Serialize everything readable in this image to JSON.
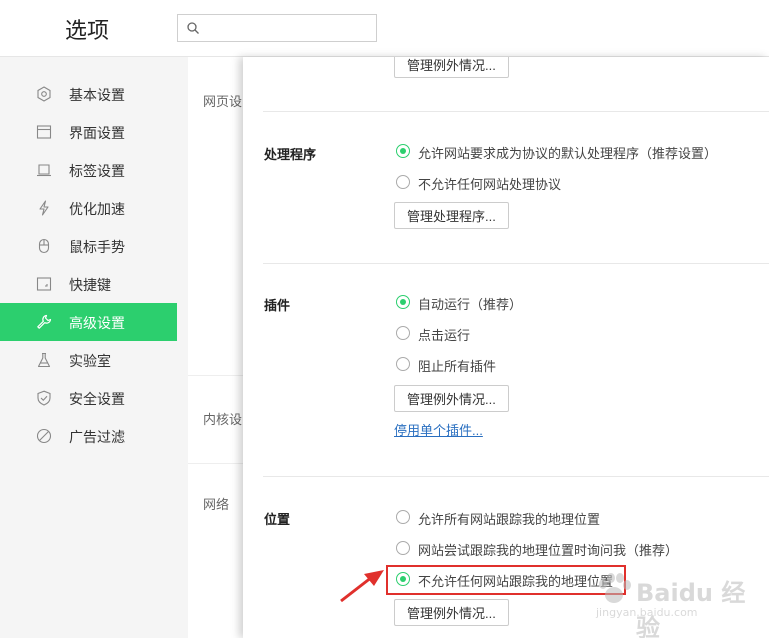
{
  "header": {
    "title": "选项",
    "search_placeholder": ""
  },
  "sidebar": {
    "items": [
      {
        "label": "基本设置",
        "icon": "gear-icon"
      },
      {
        "label": "界面设置",
        "icon": "window-icon"
      },
      {
        "label": "标签设置",
        "icon": "tab-icon"
      },
      {
        "label": "优化加速",
        "icon": "lightning-icon"
      },
      {
        "label": "鼠标手势",
        "icon": "mouse-icon"
      },
      {
        "label": "快捷键",
        "icon": "keyboard-icon"
      },
      {
        "label": "高级设置",
        "icon": "wrench-icon",
        "active": true
      },
      {
        "label": "实验室",
        "icon": "flask-icon"
      },
      {
        "label": "安全设置",
        "icon": "shield-icon"
      },
      {
        "label": "广告过滤",
        "icon": "block-icon"
      }
    ]
  },
  "middle": {
    "labels": [
      "网页设",
      "内核设",
      "网络"
    ]
  },
  "panel": {
    "top_button": "管理例外情况...",
    "handlers": {
      "title": "处理程序",
      "options": [
        "允许网站要求成为协议的默认处理程序（推荐设置）",
        "不允许任何网站处理协议"
      ],
      "selected": 0,
      "button": "管理处理程序..."
    },
    "plugins": {
      "title": "插件",
      "options": [
        "自动运行（推荐）",
        "点击运行",
        "阻止所有插件"
      ],
      "selected": 0,
      "button": "管理例外情况...",
      "link": "停用单个插件..."
    },
    "location": {
      "title": "位置",
      "options": [
        "允许所有网站跟踪我的地理位置",
        "网站尝试跟踪我的地理位置时询问我（推荐）",
        "不允许任何网站跟踪我的地理位置"
      ],
      "selected": 2,
      "button": "管理例外情况..."
    }
  },
  "watermark": {
    "brand": "Baidu 经验",
    "url": "jingyan.baidu.com"
  },
  "colors": {
    "accent": "#2ccf6e",
    "highlight": "#e0302c",
    "link": "#2a6fc0"
  }
}
